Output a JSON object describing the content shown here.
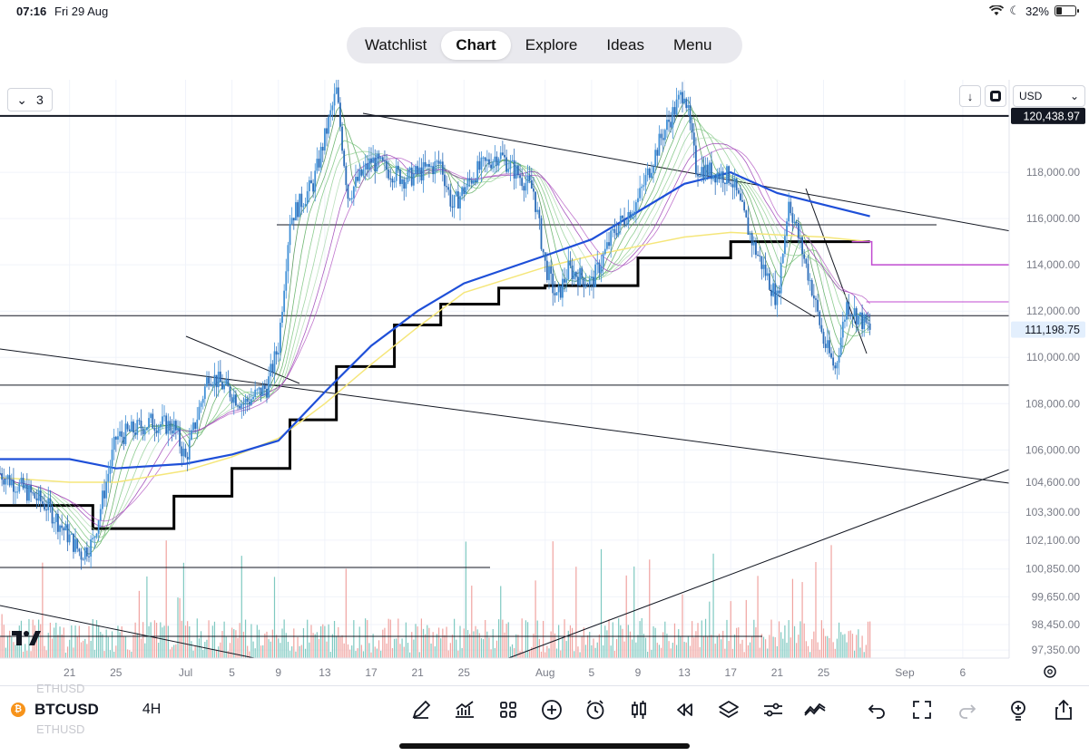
{
  "status": {
    "time": "07:16",
    "date": "Fri 29 Aug",
    "battery": "32%",
    "battery_level": 0.32
  },
  "nav": {
    "tabs": [
      {
        "label": "Watchlist",
        "active": false
      },
      {
        "label": "Chart",
        "active": true
      },
      {
        "label": "Explore",
        "active": false
      },
      {
        "label": "Ideas",
        "active": false
      },
      {
        "label": "Menu",
        "active": false
      }
    ]
  },
  "chart_controls": {
    "layout_count": "3",
    "currency": "USD"
  },
  "symbol": {
    "ticker": "BTCUSD",
    "interval": "4H",
    "ghost_above": "ETHUSD",
    "ghost_below": "ETHUSD",
    "coin_glyph": "₿"
  },
  "colors": {
    "up": "#26a69a",
    "down": "#ef5350",
    "ma_blue": "#1e4fd8",
    "ma_yellow": "#f5e67a",
    "brand": "#2962ff"
  },
  "chart_data": {
    "type": "candlestick",
    "symbol": "BTCUSD",
    "interval": "4H",
    "currency": "USD",
    "price_tick_labels": [
      "118,000.00",
      "116,000.00",
      "114,000.00",
      "112,000.00",
      "110,000.00",
      "108,000.00",
      "106,000.00",
      "104,600.00",
      "103,300.00",
      "102,100.00",
      "100,850.00",
      "99,650.00",
      "98,450.00",
      "97,350.00"
    ],
    "price_ticks": [
      118000,
      116000,
      114000,
      112000,
      110000,
      108000,
      106000,
      104600,
      103300,
      102100,
      100850,
      99650,
      98450,
      97350
    ],
    "date_tick_labels": [
      "21",
      "25",
      "Jul",
      "5",
      "9",
      "13",
      "17",
      "21",
      "25",
      "Aug",
      "5",
      "9",
      "13",
      "17",
      "21",
      "25",
      "Sep",
      "6"
    ],
    "date_ticks": [
      "2025-06-21",
      "2025-06-25",
      "2025-07-01",
      "2025-07-05",
      "2025-07-09",
      "2025-07-13",
      "2025-07-17",
      "2025-07-21",
      "2025-07-25",
      "2025-08-01",
      "2025-08-05",
      "2025-08-09",
      "2025-08-13",
      "2025-08-17",
      "2025-08-21",
      "2025-08-25",
      "2025-09-01",
      "2025-09-06"
    ],
    "price_labels": [
      {
        "text": "120,438.97",
        "value": 120438.97,
        "style": "dark"
      },
      {
        "text": "111,198.75",
        "value": 111198.75,
        "style": "light"
      }
    ],
    "close_path": [
      [
        "2025-06-15",
        105000
      ],
      [
        "2025-06-19",
        103600
      ],
      [
        "2025-06-22",
        101500
      ],
      [
        "2025-06-23",
        102000
      ],
      [
        "2025-06-25",
        106500
      ],
      [
        "2025-06-28",
        107200
      ],
      [
        "2025-06-30",
        107000
      ],
      [
        "2025-07-01",
        105600
      ],
      [
        "2025-07-03",
        109300
      ],
      [
        "2025-07-06",
        108000
      ],
      [
        "2025-07-08",
        108700
      ],
      [
        "2025-07-09",
        110500
      ],
      [
        "2025-07-10",
        116000
      ],
      [
        "2025-07-12",
        117500
      ],
      [
        "2025-07-14",
        121500
      ],
      [
        "2025-07-15",
        117000
      ],
      [
        "2025-07-17",
        118500
      ],
      [
        "2025-07-20",
        117700
      ],
      [
        "2025-07-23",
        118400
      ],
      [
        "2025-07-24",
        116500
      ],
      [
        "2025-07-26",
        118000
      ],
      [
        "2025-07-28",
        118800
      ],
      [
        "2025-07-31",
        117200
      ],
      [
        "2025-08-01",
        114000
      ],
      [
        "2025-08-02",
        112500
      ],
      [
        "2025-08-03",
        113800
      ],
      [
        "2025-08-05",
        113200
      ],
      [
        "2025-08-07",
        115500
      ],
      [
        "2025-08-09",
        116800
      ],
      [
        "2025-08-11",
        119500
      ],
      [
        "2025-08-13",
        121600
      ],
      [
        "2025-08-14",
        118200
      ],
      [
        "2025-08-17",
        117800
      ],
      [
        "2025-08-19",
        114800
      ],
      [
        "2025-08-21",
        112500
      ],
      [
        "2025-08-22",
        116800
      ],
      [
        "2025-08-24",
        113000
      ],
      [
        "2025-08-25",
        110700
      ],
      [
        "2025-08-26",
        109500
      ],
      [
        "2025-08-27",
        112300
      ],
      [
        "2025-08-29",
        111198.75
      ]
    ],
    "ma_blue_path": [
      [
        "2025-06-15",
        105600
      ],
      [
        "2025-06-21",
        105600
      ],
      [
        "2025-06-25",
        105200
      ],
      [
        "2025-07-01",
        105400
      ],
      [
        "2025-07-05",
        105800
      ],
      [
        "2025-07-09",
        106400
      ],
      [
        "2025-07-13",
        108500
      ],
      [
        "2025-07-17",
        110500
      ],
      [
        "2025-07-21",
        112000
      ],
      [
        "2025-07-25",
        113200
      ],
      [
        "2025-08-01",
        114400
      ],
      [
        "2025-08-05",
        115100
      ],
      [
        "2025-08-09",
        116300
      ],
      [
        "2025-08-13",
        117500
      ],
      [
        "2025-08-17",
        118000
      ],
      [
        "2025-08-21",
        117100
      ],
      [
        "2025-08-25",
        116600
      ],
      [
        "2025-08-29",
        116100
      ]
    ],
    "ma_yellow_path": [
      [
        "2025-06-15",
        104800
      ],
      [
        "2025-06-21",
        104600
      ],
      [
        "2025-06-25",
        104600
      ],
      [
        "2025-07-01",
        105100
      ],
      [
        "2025-07-05",
        105700
      ],
      [
        "2025-07-09",
        106500
      ],
      [
        "2025-07-13",
        108000
      ],
      [
        "2025-07-17",
        109700
      ],
      [
        "2025-07-21",
        111300
      ],
      [
        "2025-07-25",
        112800
      ],
      [
        "2025-08-01",
        113900
      ],
      [
        "2025-08-05",
        114400
      ],
      [
        "2025-08-09",
        114800
      ],
      [
        "2025-08-13",
        115200
      ],
      [
        "2025-08-17",
        115400
      ],
      [
        "2025-08-21",
        115300
      ],
      [
        "2025-08-25",
        115200
      ],
      [
        "2025-08-29",
        115000
      ]
    ],
    "step_line": [
      [
        "2025-06-15",
        103600
      ],
      [
        "2025-06-23",
        103600
      ],
      [
        "2025-06-23",
        102600
      ],
      [
        "2025-06-30",
        102600
      ],
      [
        "2025-06-30",
        104000
      ],
      [
        "2025-07-05",
        104000
      ],
      [
        "2025-07-05",
        105200
      ],
      [
        "2025-07-10",
        105200
      ],
      [
        "2025-07-10",
        107300
      ],
      [
        "2025-07-14",
        107300
      ],
      [
        "2025-07-14",
        109600
      ],
      [
        "2025-07-19",
        109600
      ],
      [
        "2025-07-19",
        111400
      ],
      [
        "2025-07-23",
        111400
      ],
      [
        "2025-07-23",
        112300
      ],
      [
        "2025-07-28",
        112300
      ],
      [
        "2025-07-28",
        113000
      ],
      [
        "2025-08-01",
        113000
      ],
      [
        "2025-08-01",
        113100
      ],
      [
        "2025-08-09",
        113100
      ],
      [
        "2025-08-09",
        114300
      ],
      [
        "2025-08-17",
        114300
      ],
      [
        "2025-08-17",
        115000
      ],
      [
        "2025-08-29",
        115000
      ]
    ],
    "horizontal_levels": [
      120438.97,
      111800,
      108800
    ],
    "y_range": [
      97000,
      122000
    ],
    "x_range": [
      "2025-06-15",
      "2025-09-10"
    ]
  },
  "toolbar": [
    {
      "name": "drawing-pen-icon"
    },
    {
      "name": "indicators-icon"
    },
    {
      "name": "layout-grid-icon"
    },
    {
      "name": "add-circle-icon"
    },
    {
      "name": "alert-clock-icon"
    },
    {
      "name": "candles-icon"
    },
    {
      "name": "replay-icon"
    },
    {
      "name": "layers-icon"
    },
    {
      "name": "settings-sliders-icon"
    },
    {
      "name": "compare-icon"
    },
    {
      "name": "undo-icon"
    },
    {
      "name": "fullscreen-icon"
    },
    {
      "name": "redo-icon"
    },
    {
      "name": "idea-bulb-icon"
    },
    {
      "name": "share-icon"
    }
  ]
}
